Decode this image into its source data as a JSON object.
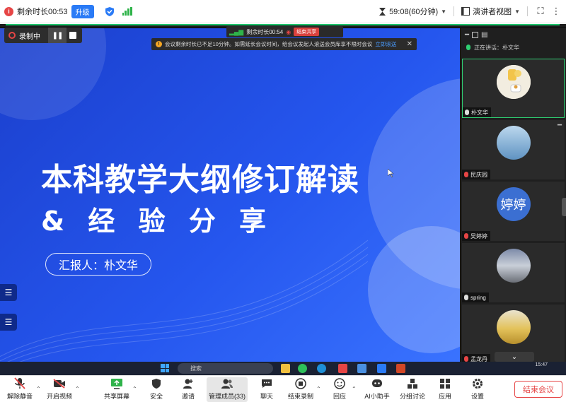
{
  "topbar": {
    "remaining_label": "剩余时长00:53",
    "upgrade_label": "升级",
    "timer": "59:08(60分钟)",
    "view_label": "演讲者视图"
  },
  "recording": {
    "label": "录制中"
  },
  "share_bar": {
    "remaining": "剩余时长00:54",
    "stop_label": "结束共享"
  },
  "notice": {
    "text": "会议剩余时长已不足10分钟。如需延长会议时间，给会议发起人滚送会员库享不限时会议",
    "link": "立即滚送"
  },
  "slide": {
    "title": "本科教学大纲修订解读",
    "subtitle": "& 经 验 分 享",
    "reporter": "汇报人：朴文华"
  },
  "taskbar": {
    "search_placeholder": "搜索",
    "time": "15:47"
  },
  "panel": {
    "speaking_label": "正在讲话：朴文华",
    "participants": [
      {
        "name": "朴文华",
        "muted": false,
        "active": true
      },
      {
        "name": "民庆园",
        "muted": true,
        "active": false
      },
      {
        "name": "吴婷婷",
        "muted": true,
        "active": false,
        "avatar_text": "婷婷"
      },
      {
        "name": "spring",
        "muted": false,
        "active": false
      },
      {
        "name": "孟龙丹",
        "muted": true,
        "active": false
      }
    ]
  },
  "toolbar": {
    "items": [
      {
        "label": "解除静音",
        "icon": "mic-muted-icon"
      },
      {
        "label": "开启视频",
        "icon": "video-off-icon"
      },
      {
        "label": "共享屏幕",
        "icon": "screen-share-icon"
      },
      {
        "label": "安全",
        "icon": "shield-icon"
      },
      {
        "label": "邀请",
        "icon": "add-user-icon"
      },
      {
        "label": "管理成员(33)",
        "icon": "members-icon"
      },
      {
        "label": "聊天",
        "icon": "chat-icon"
      },
      {
        "label": "结束录制",
        "icon": "stop-record-icon"
      },
      {
        "label": "回应",
        "icon": "emoji-icon"
      },
      {
        "label": "AI小助手",
        "icon": "ai-assistant-icon"
      },
      {
        "label": "分组讨论",
        "icon": "breakout-icon"
      },
      {
        "label": "应用",
        "icon": "apps-icon"
      },
      {
        "label": "设置",
        "icon": "gear-icon"
      }
    ],
    "end_label": "结束会议"
  },
  "colors": {
    "accent": "#2a7bf6",
    "danger": "#e64545",
    "speaking": "#2fcf72",
    "slide_blue": "#2556ee"
  }
}
